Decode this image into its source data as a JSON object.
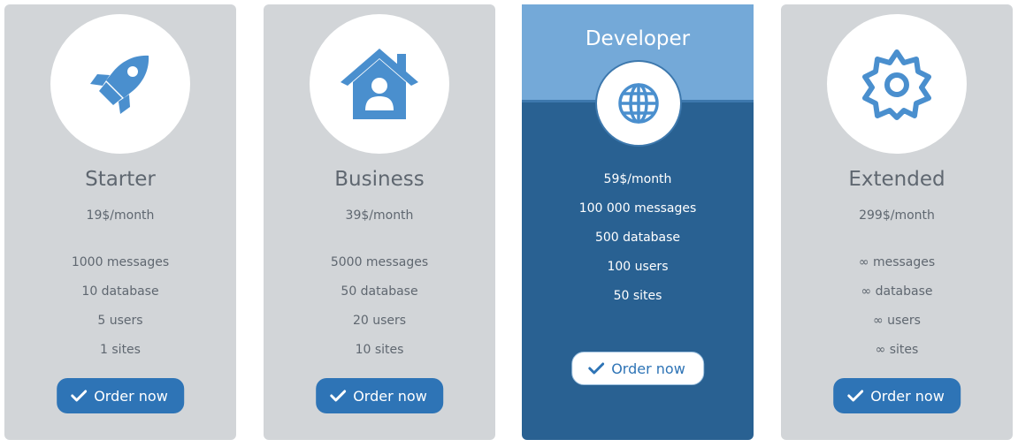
{
  "colors": {
    "card_bg": "#d2d5d8",
    "icon_blue": "#4a8fce",
    "button_blue": "#2e74b6",
    "featured_header": "#74a9d8",
    "featured_body": "#296192",
    "text_gray": "#5f6770"
  },
  "plans": [
    {
      "name": "Starter",
      "icon": "rocket-icon",
      "price": "19$/month",
      "features": [
        "1000 messages",
        "10 database",
        "5 users",
        "1 sites"
      ],
      "button_label": "Order now"
    },
    {
      "name": "Business",
      "icon": "home-user-icon",
      "price": "39$/month",
      "features": [
        "5000 messages",
        "50 database",
        "20 users",
        "10 sites"
      ],
      "button_label": "Order now"
    },
    {
      "name": "Developer",
      "icon": "globe-icon",
      "price": "59$/month",
      "features": [
        "100 000 messages",
        "500 database",
        "100 users",
        "50 sites"
      ],
      "button_label": "Order now",
      "featured": true
    },
    {
      "name": "Extended",
      "icon": "gear-icon",
      "price": "299$/month",
      "features": [
        "∞ messages",
        "∞ database",
        "∞ users",
        "∞ sites"
      ],
      "button_label": "Order now"
    }
  ]
}
